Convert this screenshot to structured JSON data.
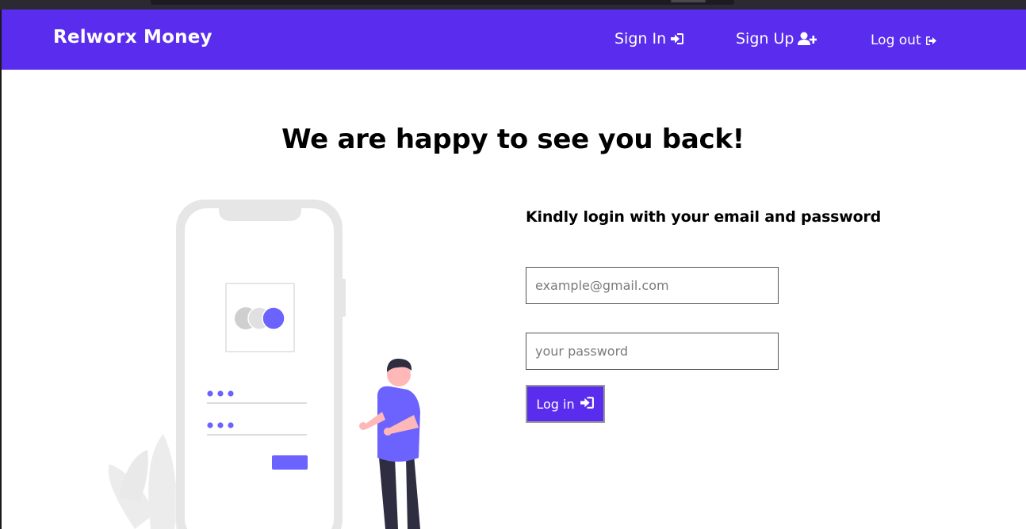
{
  "navbar": {
    "brand": "Relworx Money",
    "sign_in": "Sign In",
    "sign_up": "Sign Up",
    "log_out": "Log out"
  },
  "main": {
    "heading": "We are happy to see you back!",
    "subheading": "Kindly login with your email and password",
    "email_placeholder": "example@gmail.com",
    "password_placeholder": "your password",
    "login_label": "Log in"
  },
  "colors": {
    "brand": "#5a2ced",
    "illustration_accent": "#6c63ff"
  },
  "icons": {
    "sign_in": "sign-in-icon",
    "sign_up": "user-plus-icon",
    "log_out": "sign-out-icon",
    "login": "sign-in-icon"
  }
}
